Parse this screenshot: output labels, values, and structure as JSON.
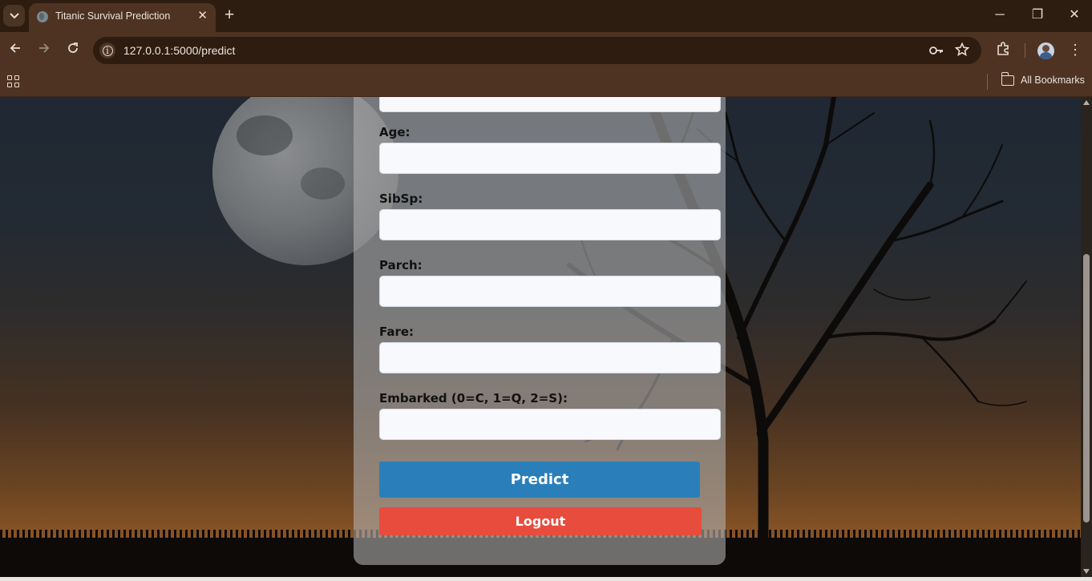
{
  "browser": {
    "tab_title": "Titanic Survival Prediction",
    "tab_close": "✕",
    "new_tab": "+",
    "url": "127.0.0.1:5000/predict",
    "bookmarks_label": "All Bookmarks",
    "window_controls": {
      "minimize": "─",
      "restore": "❐",
      "close": "✕"
    }
  },
  "form": {
    "fields": [
      {
        "label": "",
        "value": ""
      },
      {
        "label": "Age:",
        "value": ""
      },
      {
        "label": "SibSp:",
        "value": ""
      },
      {
        "label": "Parch:",
        "value": ""
      },
      {
        "label": "Fare:",
        "value": ""
      },
      {
        "label": "Embarked (0=C, 1=Q, 2=S):",
        "value": ""
      }
    ],
    "predict_label": "Predict",
    "logout_label": "Logout"
  },
  "colors": {
    "predict_button": "#2a7fba",
    "logout_button": "#e74c3c",
    "browser_frame": "#4e3322"
  },
  "icons": [
    "tab-search-icon",
    "globe-favicon-icon",
    "back-arrow-icon",
    "forward-arrow-icon",
    "reload-icon",
    "site-info-icon",
    "password-key-icon",
    "bookmark-star-icon",
    "extensions-icon",
    "profile-avatar",
    "menu-dots-icon",
    "apps-grid-icon",
    "folder-icon"
  ]
}
